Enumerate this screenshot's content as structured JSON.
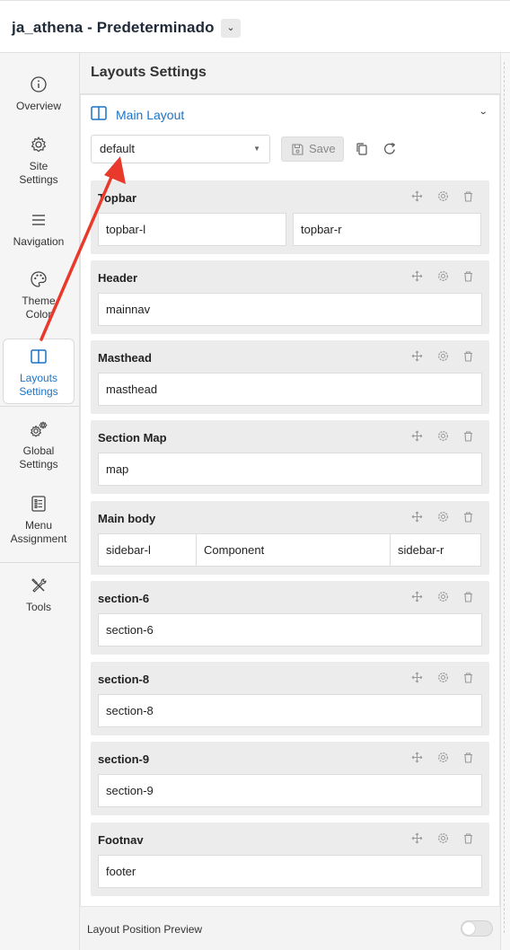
{
  "header": {
    "title": "ja_athena - Predeterminado"
  },
  "sidebar": {
    "items": [
      {
        "label": "Overview",
        "icon": "info-icon"
      },
      {
        "label": "Site\nSettings",
        "icon": "gear-icon"
      },
      {
        "label": "Navigation",
        "icon": "menu-icon"
      },
      {
        "label": "Theme\nColor",
        "icon": "palette-icon"
      },
      {
        "label": "Layouts\nSettings",
        "icon": "layout-columns-icon",
        "active": true
      },
      {
        "label": "Global\nSettings",
        "icon": "gears-icon"
      },
      {
        "label": "Menu\nAssignment",
        "icon": "list-icon"
      },
      {
        "label": "Tools",
        "icon": "tools-icon"
      }
    ],
    "active_color": "#1a73c8"
  },
  "main": {
    "heading": "Layouts Settings",
    "panel_title": "Main Layout",
    "layout_select": {
      "value": "default"
    },
    "save_label": "Save",
    "blocks": [
      {
        "name": "Topbar",
        "positions": [
          "topbar-l",
          "topbar-r"
        ]
      },
      {
        "name": "Header",
        "positions": [
          "mainnav"
        ]
      },
      {
        "name": "Masthead",
        "positions": [
          "masthead"
        ]
      },
      {
        "name": "Section Map",
        "positions": [
          "map"
        ]
      },
      {
        "name": "Main body",
        "positions": [
          "sidebar-l",
          "Component",
          "sidebar-r"
        ]
      },
      {
        "name": "section-6",
        "positions": [
          "section-6"
        ]
      },
      {
        "name": "section-8",
        "positions": [
          "section-8"
        ]
      },
      {
        "name": "section-9",
        "positions": [
          "section-9"
        ]
      },
      {
        "name": "Footnav",
        "positions": [
          "footer"
        ]
      }
    ],
    "preview_label": "Layout Position Preview",
    "preview_enabled": false
  },
  "annotation": {
    "color": "#e8392b"
  }
}
